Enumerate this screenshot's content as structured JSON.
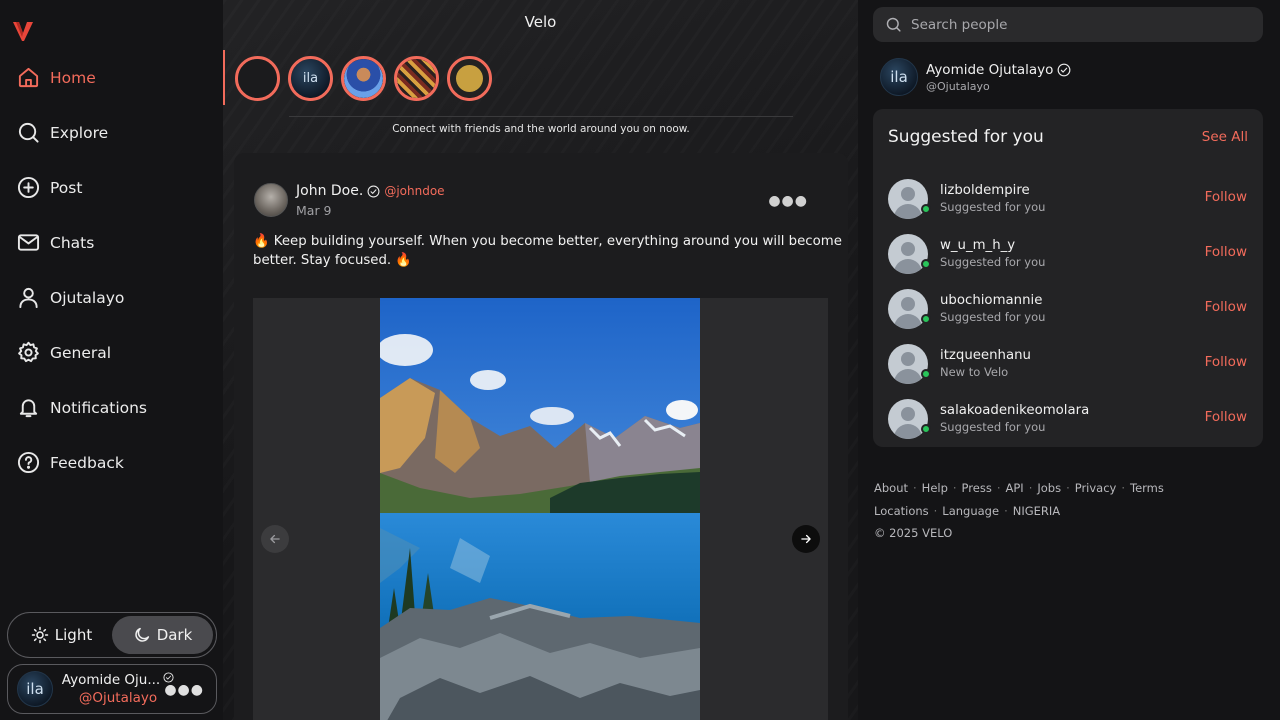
{
  "app": {
    "title": "Velo"
  },
  "nav": {
    "items": [
      {
        "label": "Home",
        "icon": "home-icon",
        "active": true
      },
      {
        "label": "Explore",
        "icon": "search-icon"
      },
      {
        "label": "Post",
        "icon": "plus-circle-icon"
      },
      {
        "label": "Chats",
        "icon": "mail-icon"
      },
      {
        "label": "Ojutalayo",
        "icon": "user-icon"
      },
      {
        "label": "General",
        "icon": "gear-icon"
      },
      {
        "label": "Notifications",
        "icon": "bell-icon"
      },
      {
        "label": "Feedback",
        "icon": "help-circle-icon"
      }
    ]
  },
  "theme": {
    "light_label": "Light",
    "dark_label": "Dark",
    "selected": "Dark"
  },
  "current_user": {
    "name": "Ayomide Ojutalayo",
    "name_truncated": "Ayomide Oju...",
    "handle": "@Ojutalayo",
    "avatar_text": "ila"
  },
  "stories": {
    "tagline": "Connect with friends and the world around you on noow."
  },
  "post": {
    "author_name": "John Doe.",
    "author_handle": "@johndoe",
    "date": "Mar 9",
    "text": "🔥 Keep building yourself. When you become better, everything around you will become better. Stay focused. 🔥"
  },
  "search": {
    "placeholder": "Search people"
  },
  "suggested": {
    "title": "Suggested for you",
    "see_all": "See All",
    "follow_label": "Follow",
    "users": [
      {
        "username": "lizboldempire",
        "subtitle": "Suggested for you"
      },
      {
        "username": "w_u_m_h_y",
        "subtitle": "Suggested for you"
      },
      {
        "username": "ubochiomannie",
        "subtitle": "Suggested for you"
      },
      {
        "username": "itzqueenhanu",
        "subtitle": "New to Velo"
      },
      {
        "username": "salakoadenikeomolara",
        "subtitle": "Suggested for you"
      }
    ]
  },
  "footer": {
    "links_row1": [
      "About",
      "Help",
      "Press",
      "API",
      "Jobs",
      "Privacy",
      "Terms"
    ],
    "links_row2": [
      "Locations",
      "Language",
      "NIGERIA"
    ],
    "copyright": "© 2025 VELO"
  },
  "colors": {
    "accent": "#f26b5b",
    "online": "#29c45a",
    "background": "#141416",
    "card": "#232325"
  }
}
